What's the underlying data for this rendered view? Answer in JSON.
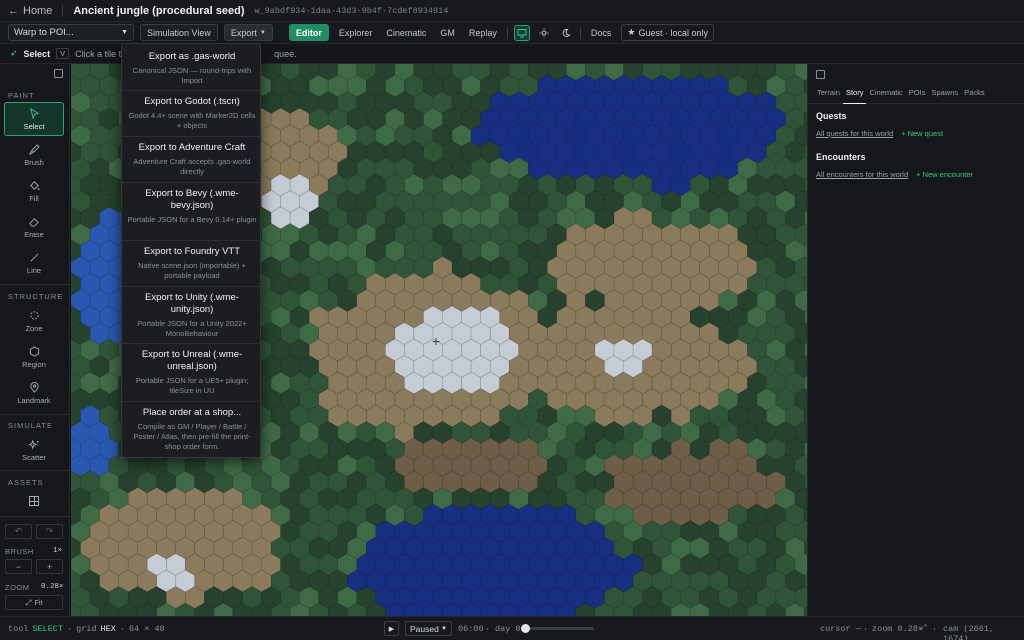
{
  "header": {
    "home_label": "Home",
    "world_title": "Ancient jungle (procedural seed)",
    "world_id": "w_9abdf934-1daa-43d3-9b4f-7cdef8934914"
  },
  "toolbar": {
    "warp_select": "Warp to POI...",
    "simulation_view": "Simulation View",
    "export": "Export",
    "modes": [
      "Editor",
      "Explorer",
      "Cinematic",
      "GM",
      "Replay"
    ],
    "active_mode": "Editor",
    "docs": "Docs",
    "guest": "Guest · local only"
  },
  "hint": {
    "tool": "Select",
    "key": "V",
    "text_start": "Click a tile to s",
    "text_end": "quee."
  },
  "left": {
    "paint_title": "PAINT",
    "paint_tools": [
      "Select",
      "Brush",
      "Fill",
      "Erase",
      "Line"
    ],
    "structure_title": "STRUCTURE",
    "structure_tools": [
      "Zone",
      "Region",
      "Landmark"
    ],
    "simulate_title": "SIMULATE",
    "simulate_tools": [
      "Scatter"
    ],
    "assets_title": "ASSETS",
    "brush_label": "BRUSH",
    "brush_value": "1×",
    "zoom_label": "ZOOM",
    "zoom_value": "0.28×",
    "fit_label": "Fit"
  },
  "export_menu": [
    {
      "title": "Export as .gas-world",
      "desc": "Canonical JSON — round-trips with Import"
    },
    {
      "title": "Export to Godot (.tscn)",
      "desc": "Godot 4.4+ scene with Marker2D cells + objects"
    },
    {
      "title": "Export to Adventure Craft",
      "desc": "Adventure Craft accepts .gas-world directly"
    },
    {
      "title": "Export to Bevy (.wme-bevy.json)",
      "desc": "Portable JSON for a Bevy 0.14+ plugin"
    },
    {
      "title": "Export to Foundry VTT",
      "desc": "Native scene.json (importable) + portable payload"
    },
    {
      "title": "Export to Unity (.wme-unity.json)",
      "desc": "Portable JSON for a Unity 2022+ MonoBehaviour"
    },
    {
      "title": "Export to Unreal (.wme-unreal.json)",
      "desc": "Portable JSON for a UE5+ plugin; tileSize in UU"
    },
    {
      "title": "Place order at a shop...",
      "desc": "Compile as GM / Player / Battle / Poster / Atlas, then pre-fill the print-shop order form."
    }
  ],
  "right": {
    "tabs": [
      "Terrain",
      "Story",
      "Cinematic",
      "POIs",
      "Spawns",
      "Packs"
    ],
    "active_tab": "Story",
    "quests_heading": "Quests",
    "quests_link": "All quests for this world",
    "new_quest": "+ New quest",
    "encounters_heading": "Encounters",
    "encounters_link": "All encounters for this world",
    "new_encounter": "+ New encounter"
  },
  "status": {
    "tool_label": "tool",
    "tool_value": "SELECT",
    "grid_label": "grid",
    "grid_value": "HEX",
    "dims": "64 × 48",
    "paused": "Paused",
    "time": "06:00",
    "day": "day 8",
    "cursor": "cursor —",
    "zoom": "zoom 0.28×",
    "cam": "cam (2661, 1674)"
  },
  "colors": {
    "accent": "#1f8f63",
    "accent_text": "#35c98a",
    "biomes": {
      "deep_water": "#162f80",
      "water": "#2a58b0",
      "shallow": "#3a77b5",
      "jungle_dark": "#26412e",
      "jungle": "#2f5437",
      "grass": "#3f6a46",
      "sand": "#8b7a5c",
      "dirt": "#6e5e48",
      "snow": "#c6ccd6"
    }
  }
}
